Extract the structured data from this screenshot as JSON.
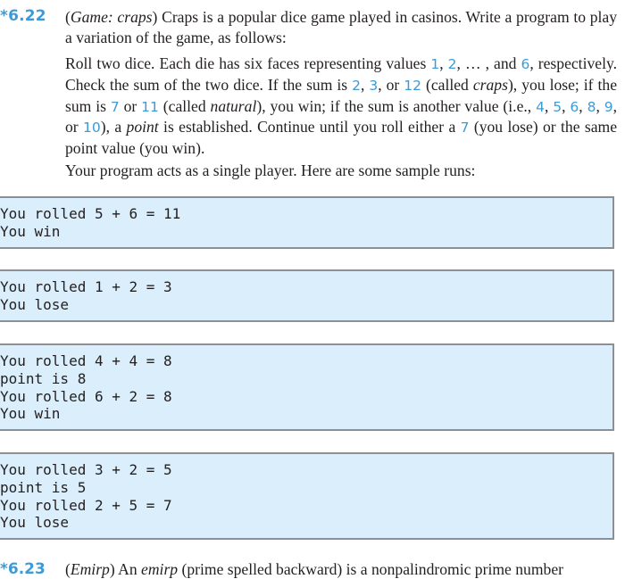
{
  "exercise": {
    "number": "*6.22",
    "title": "Game: craps",
    "intro_after_title": " Craps is a popular dice game played in casinos. Write a program to play a variation of the game, as follows:",
    "rules": {
      "t1": "Roll two dice. Each die has six faces representing values ",
      "v1": "1",
      "t2": ", ",
      "v2": "2",
      "t3": ", … , and ",
      "v3": "6",
      "t4": ", respectively. Check the sum of the two dice. If the sum is ",
      "v4": "2",
      "t5": ", ",
      "v5": "3",
      "t6": ", or ",
      "v6": "12",
      "t7": " (called ",
      "i1": "craps",
      "t8": "), you lose; if the sum is ",
      "v7": "7",
      "t9": " or ",
      "v8": "11",
      "t10": " (called ",
      "i2": "natural",
      "t11": "), you win; if the sum is another value (i.e., ",
      "v9": "4",
      "t12": ", ",
      "v10": "5",
      "t13": ", ",
      "v11": "6",
      "t14": ", ",
      "v12": "8",
      "t15": ", ",
      "v13": "9",
      "t16": ", or ",
      "v14": "10",
      "t17": "), a ",
      "i3": "point",
      "t18": " is established. Continue until you roll either a ",
      "v15": "7",
      "t19": " (you lose) or the same point value (you win)."
    },
    "sample_intro": "Your program acts as a single player. Here are some sample runs:"
  },
  "sample_runs": [
    {
      "lines": [
        "You rolled 5 + 6 = 11",
        "You win"
      ]
    },
    {
      "lines": [
        "You rolled 1 + 2 = 3",
        "You lose"
      ]
    },
    {
      "lines": [
        "You rolled 4 + 4 = 8",
        "point is 8",
        "You rolled 6 + 2 = 8",
        "You win"
      ]
    },
    {
      "lines": [
        "You rolled 3 + 2 = 5",
        "point is 5",
        "You rolled 2 + 5 = 7",
        "You lose"
      ]
    }
  ],
  "next_exercise": {
    "number": "*6.23",
    "title": "Emirp",
    "t1": " An ",
    "i1": "emirp",
    "t2": " (prime spelled backward) is a nonpalindromic prime number"
  },
  "colors": {
    "accent": "#3c9ad6",
    "box_fill": "#daeefb",
    "box_border": "#8c8f93",
    "text": "#231f20"
  }
}
